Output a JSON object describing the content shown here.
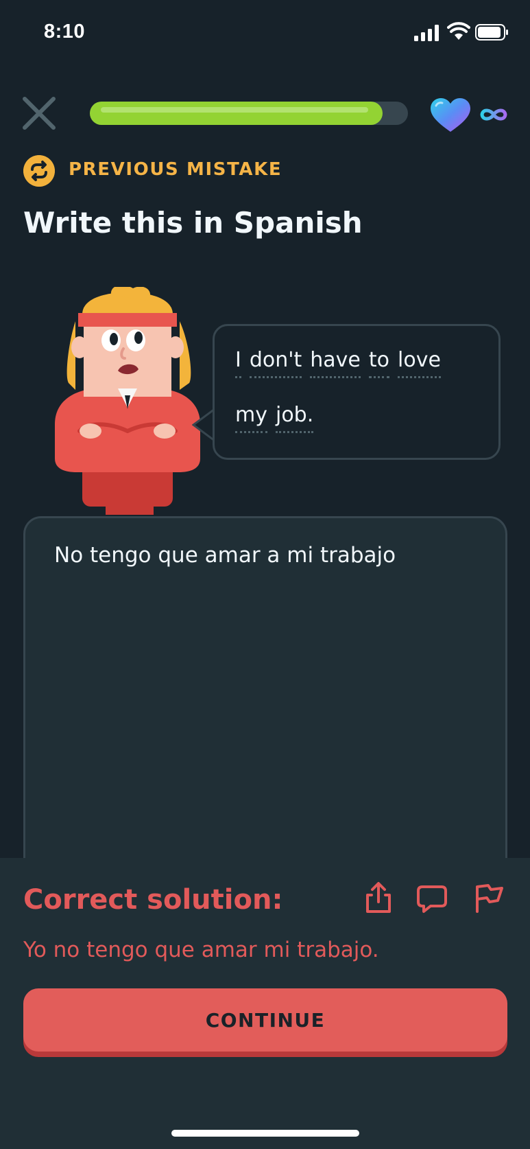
{
  "status_bar": {
    "time": "8:10"
  },
  "top_bar": {
    "progress": 0.92,
    "hearts": "∞"
  },
  "mistake_tag": {
    "label": "PREVIOUS MISTAKE"
  },
  "exercise": {
    "title": "Write this in Spanish",
    "prompt_line1": [
      "I",
      "don't",
      "have",
      "to",
      "love"
    ],
    "prompt_line2": [
      "my",
      "job."
    ]
  },
  "answer": {
    "value": "No tengo que amar a mi trabajo"
  },
  "feedback": {
    "heading": "Correct solution:",
    "solution": "Yo no tengo que amar mi trabajo.",
    "continue_label": "CONTINUE"
  },
  "colors": {
    "background": "#17222a",
    "progress": "#93d333",
    "accent_orange": "#f5b447",
    "error_red": "#e25a5a"
  },
  "icons": [
    "close-icon",
    "heart-icon",
    "infinity-icon",
    "repeat-icon",
    "share-icon",
    "comment-icon",
    "flag-icon"
  ]
}
